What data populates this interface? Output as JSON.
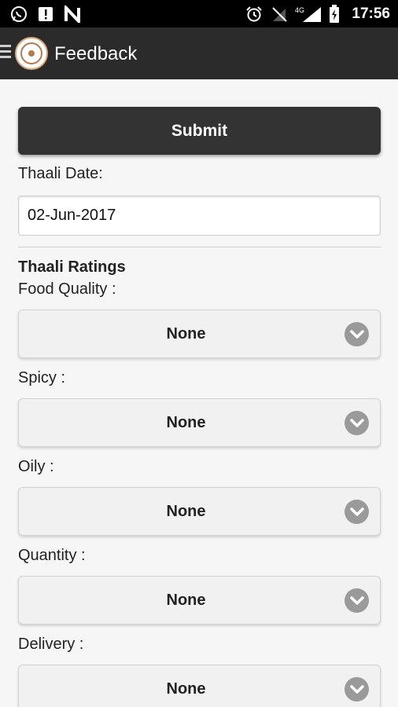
{
  "status_bar": {
    "time": "17:56",
    "network": "4G",
    "left_icons": [
      "whatsapp-icon",
      "alert-icon",
      "n-app-icon"
    ],
    "right_icons": [
      "alarm-icon",
      "no-signal-icon",
      "cell-signal-icon",
      "battery-icon"
    ]
  },
  "app_bar": {
    "title": "Feedback",
    "menu_icon": "hamburger-icon",
    "logo_icon": "app-logo"
  },
  "form": {
    "submit_label": "Submit",
    "date_label": "Thaali Date:",
    "date_value": "02-Jun-2017",
    "ratings_title": "Thaali Ratings",
    "ratings": [
      {
        "label": "Food Quality :",
        "value": "None"
      },
      {
        "label": "Spicy :",
        "value": "None"
      },
      {
        "label": "Oily :",
        "value": "None"
      },
      {
        "label": "Quantity :",
        "value": "None"
      },
      {
        "label": "Delivery :",
        "value": "None"
      }
    ]
  },
  "colors": {
    "status_bar_bg": "#000000",
    "app_bar_bg": "#2b2b2b",
    "button_bg": "#333333",
    "page_bg": "#f6f6f6",
    "chevron_bg": "#9a9a9a"
  }
}
